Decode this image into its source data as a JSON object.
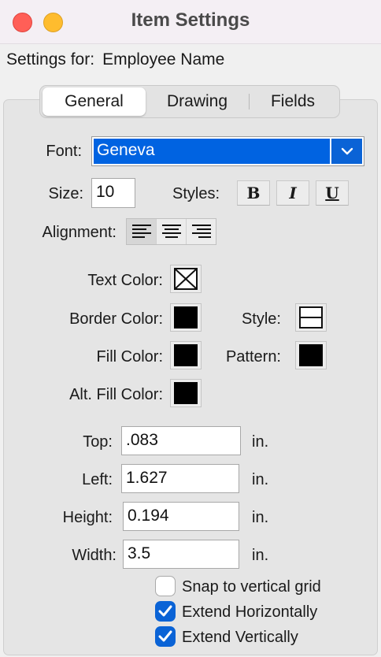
{
  "window": {
    "title": "Item Settings"
  },
  "settings_for": {
    "label": "Settings for:",
    "value": "Employee Name"
  },
  "tabs": [
    {
      "label": "General",
      "active": true
    },
    {
      "label": "Drawing",
      "active": false
    },
    {
      "label": "Fields",
      "active": false
    }
  ],
  "font": {
    "label": "Font:",
    "value": "Geneva"
  },
  "size": {
    "label": "Size:",
    "value": "10"
  },
  "styles": {
    "label": "Styles:",
    "bold": "B",
    "italic": "I",
    "underline": "U"
  },
  "alignment": {
    "label": "Alignment:",
    "selected": "left"
  },
  "colors": {
    "text_color": "Text Color:",
    "border_color": "Border Color:",
    "fill_color": "Fill Color:",
    "alt_fill_color": "Alt. Fill Color:",
    "style": "Style:",
    "pattern": "Pattern:",
    "swatch_color": "#000000"
  },
  "position": {
    "top": {
      "label": "Top:",
      "value": ".083",
      "unit": "in."
    },
    "left": {
      "label": "Left:",
      "value": "1.627",
      "unit": "in."
    },
    "height": {
      "label": "Height:",
      "value": "0.194",
      "unit": "in."
    },
    "width": {
      "label": "Width:",
      "value": "3.5",
      "unit": "in."
    }
  },
  "checkboxes": {
    "snap": {
      "label": "Snap to vertical grid",
      "checked": false
    },
    "extend_h": {
      "label": "Extend Horizontally",
      "checked": true
    },
    "extend_v": {
      "label": "Extend Vertically",
      "checked": true
    }
  },
  "accent_color": "#0a63d6"
}
